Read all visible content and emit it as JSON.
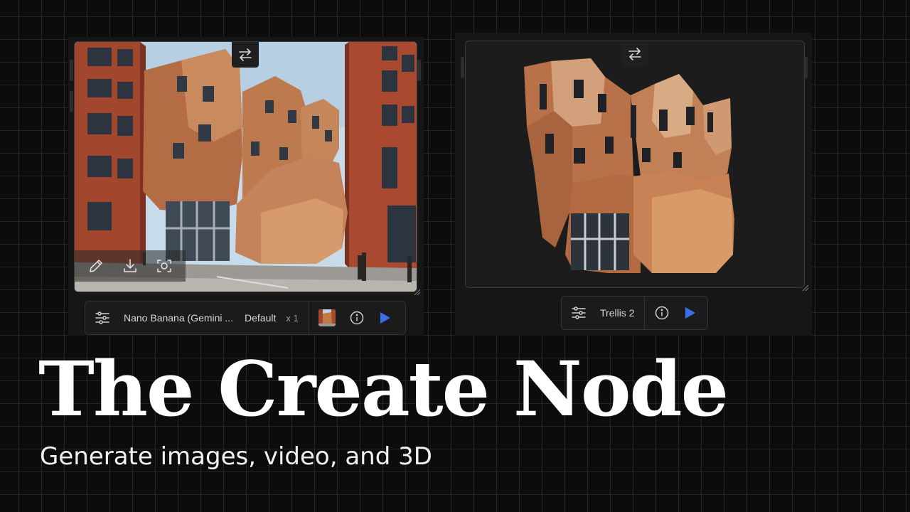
{
  "left_node": {
    "image_alt": "Photo of a deconstructivist copper-clad building between red brick buildings",
    "tools": [
      "pencil-icon",
      "download-icon",
      "camera-icon"
    ],
    "toolbar": {
      "model": "Nano Banana (Gemini ...",
      "preset": "Default",
      "count": "x 1"
    }
  },
  "right_node": {
    "image_alt": "3D model of the copper building on a dark background",
    "toolbar": {
      "model": "Trellis 2"
    }
  },
  "headline": {
    "title": "The Create Node",
    "subtitle": "Generate images, video, and 3D"
  },
  "colors": {
    "background": "#0c0c0c",
    "grid": "#262626",
    "run_accent": "#3b6fe8",
    "copper": "#c07a4c",
    "brick": "#a2462e",
    "sky": "#bcd3e6"
  }
}
